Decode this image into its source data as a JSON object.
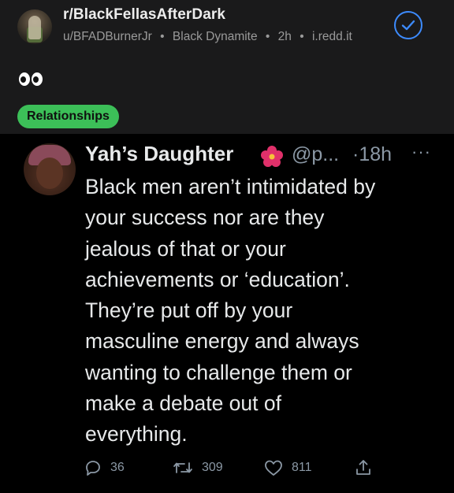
{
  "post": {
    "subreddit": "r/BlackFellasAfterDark",
    "author": "u/BFADBurnerJr",
    "author_flair": "Black Dynamite",
    "age": "2h",
    "domain": "i.redd.it",
    "title_emoji": "👀",
    "flair": "Relationships",
    "accent_color": "#3d8bfd",
    "flair_color": "#3cbf58"
  },
  "tweet": {
    "display_name": "Yah’s Daughter",
    "name_emoji": "hibiscus-flower",
    "handle": "@p...",
    "time": "·18h",
    "more": "···",
    "body_lines": [
      "Black men aren’t intimidated by",
      "your success nor are they",
      "jealous of that or your",
      "achievements or ‘education’.",
      "They’re put off by your",
      "masculine energy and always",
      "wanting to challenge them or",
      "make a debate out of",
      "everything."
    ],
    "replies": "36",
    "retweets": "309",
    "likes": "811",
    "icons": [
      "reply-icon",
      "retweet-icon",
      "like-icon",
      "share-icon"
    ]
  }
}
